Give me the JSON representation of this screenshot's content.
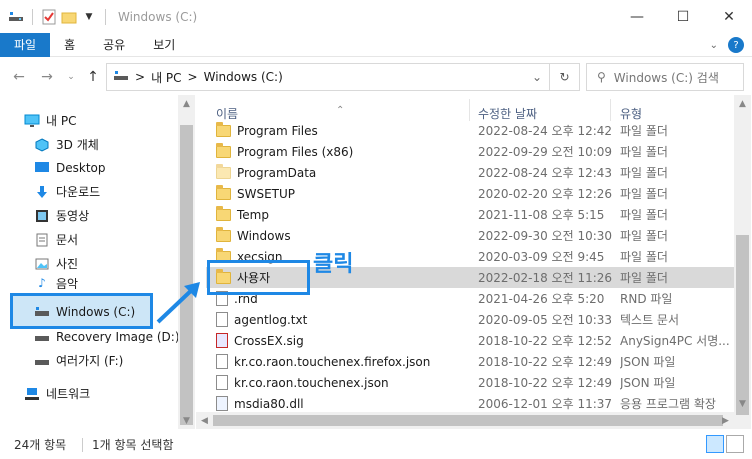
{
  "window": {
    "title": "Windows (C:)",
    "minimize": "—",
    "maximize": "☐",
    "close": "✕"
  },
  "ribbon": {
    "tabs": [
      "파일",
      "홈",
      "공유",
      "보기"
    ],
    "help": "?"
  },
  "address": {
    "path": [
      "내 PC",
      "Windows (C:)"
    ],
    "separator": ">",
    "search_placeholder": "Windows (C:) 검색"
  },
  "navpane": {
    "items": [
      {
        "label": "내 PC",
        "icon": "pc-icon"
      },
      {
        "label": "3D 개체",
        "icon": "3d-objects-icon"
      },
      {
        "label": "Desktop",
        "icon": "desktop-icon"
      },
      {
        "label": "다운로드",
        "icon": "download-icon"
      },
      {
        "label": "동영상",
        "icon": "video-icon"
      },
      {
        "label": "문서",
        "icon": "document-icon"
      },
      {
        "label": "사진",
        "icon": "picture-icon"
      },
      {
        "label": "음악",
        "icon": "music-icon"
      },
      {
        "label": "Windows (C:)",
        "icon": "drive-icon"
      },
      {
        "label": "Recovery Image (D:)",
        "icon": "drive-icon"
      },
      {
        "label": "여러가지 (F:)",
        "icon": "drive-icon"
      },
      {
        "label": "네트워크",
        "icon": "network-icon"
      }
    ]
  },
  "columns": {
    "name": "이름",
    "date": "수정한 날짜",
    "type": "유형"
  },
  "rows": [
    {
      "name": "Program Files",
      "date": "2022-08-24 오후 12:42",
      "type": "파일 폴더",
      "kind": "folder"
    },
    {
      "name": "Program Files (x86)",
      "date": "2022-09-29 오전 10:09",
      "type": "파일 폴더",
      "kind": "folder"
    },
    {
      "name": "ProgramData",
      "date": "2022-08-24 오후 12:43",
      "type": "파일 폴더",
      "kind": "folder-light"
    },
    {
      "name": "SWSETUP",
      "date": "2020-02-20 오후 12:26",
      "type": "파일 폴더",
      "kind": "folder"
    },
    {
      "name": "Temp",
      "date": "2021-11-08 오후 5:15",
      "type": "파일 폴더",
      "kind": "folder"
    },
    {
      "name": "Windows",
      "date": "2022-09-30 오전 10:30",
      "type": "파일 폴더",
      "kind": "folder"
    },
    {
      "name": "xecsign",
      "date": "2020-03-09 오전 9:45",
      "type": "파일 폴더",
      "kind": "folder"
    },
    {
      "name": "사용자",
      "date": "2022-02-18 오전 11:26",
      "type": "파일 폴더",
      "kind": "folder"
    },
    {
      "name": ".rnd",
      "date": "2021-04-26 오후 5:20",
      "type": "RND 파일",
      "kind": "file"
    },
    {
      "name": "agentlog.txt",
      "date": "2020-09-05 오전 10:33",
      "type": "텍스트 문서",
      "kind": "file"
    },
    {
      "name": "CrossEX.sig",
      "date": "2018-10-22 오후 12:52",
      "type": "AnySign4PC 서명...",
      "kind": "sig"
    },
    {
      "name": "kr.co.raon.touchenex.firefox.json",
      "date": "2018-10-22 오후 12:49",
      "type": "JSON 파일",
      "kind": "file"
    },
    {
      "name": "kr.co.raon.touchenex.json",
      "date": "2018-10-22 오후 12:49",
      "type": "JSON 파일",
      "kind": "file"
    },
    {
      "name": "msdia80.dll",
      "date": "2006-12-01 오후 11:37",
      "type": "응용 프로그램 확장",
      "kind": "dll"
    }
  ],
  "annotation": {
    "click_label": "클릭"
  },
  "status": {
    "count": "24개 항목",
    "selected": "1개 항목 선택함"
  },
  "colors": {
    "accent": "#1979ca",
    "highlight": "#1e88e5",
    "folder": "#f8d775"
  }
}
